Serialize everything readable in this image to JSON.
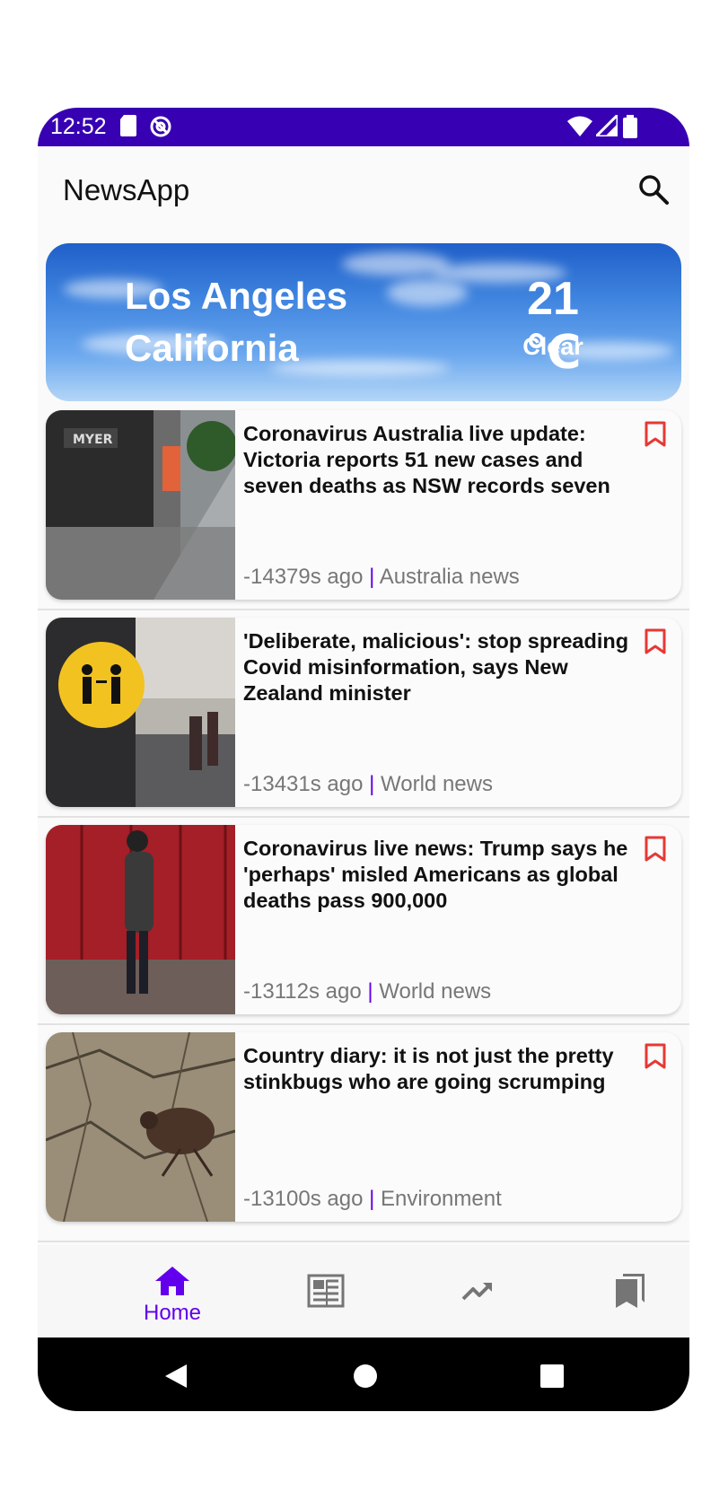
{
  "status_bar": {
    "time": "12:52",
    "bg_color": "#3700b3"
  },
  "app_bar": {
    "title": "NewsApp",
    "search_icon": "search-icon"
  },
  "weather": {
    "city": "Los Angeles",
    "region": "California",
    "temperature": "21 ℃",
    "condition": "Clear"
  },
  "articles": [
    {
      "headline": "Coronavirus Australia live update: Victoria reports 51 new cases and seven deaths as NSW records seven …",
      "time": "-14379s ago",
      "separator": "|",
      "section": "Australia news"
    },
    {
      "headline": "'Deliberate, malicious': stop spreading Covid misinformation, says New Zealand minister",
      "time": "-13431s ago",
      "separator": "|",
      "section": "World news"
    },
    {
      "headline": "Coronavirus live news: Trump says he 'perhaps' misled Americans as global deaths pass 900,000",
      "time": "-13112s ago",
      "separator": "|",
      "section": "World news"
    },
    {
      "headline": "Country diary: it is not just the pretty stinkbugs who are going scrumping",
      "time": "-13100s ago",
      "separator": "|",
      "section": "Environment"
    }
  ],
  "bottom_nav": {
    "items": [
      {
        "label": "Home",
        "icon": "home-icon",
        "selected": true
      },
      {
        "label": "",
        "icon": "newspaper-icon",
        "selected": false
      },
      {
        "label": "",
        "icon": "trending-icon",
        "selected": false
      },
      {
        "label": "",
        "icon": "bookmarks-icon",
        "selected": false
      }
    ]
  },
  "colors": {
    "accent": "#6200ee",
    "bookmark": "#e53935",
    "status_bar": "#3700b3"
  }
}
